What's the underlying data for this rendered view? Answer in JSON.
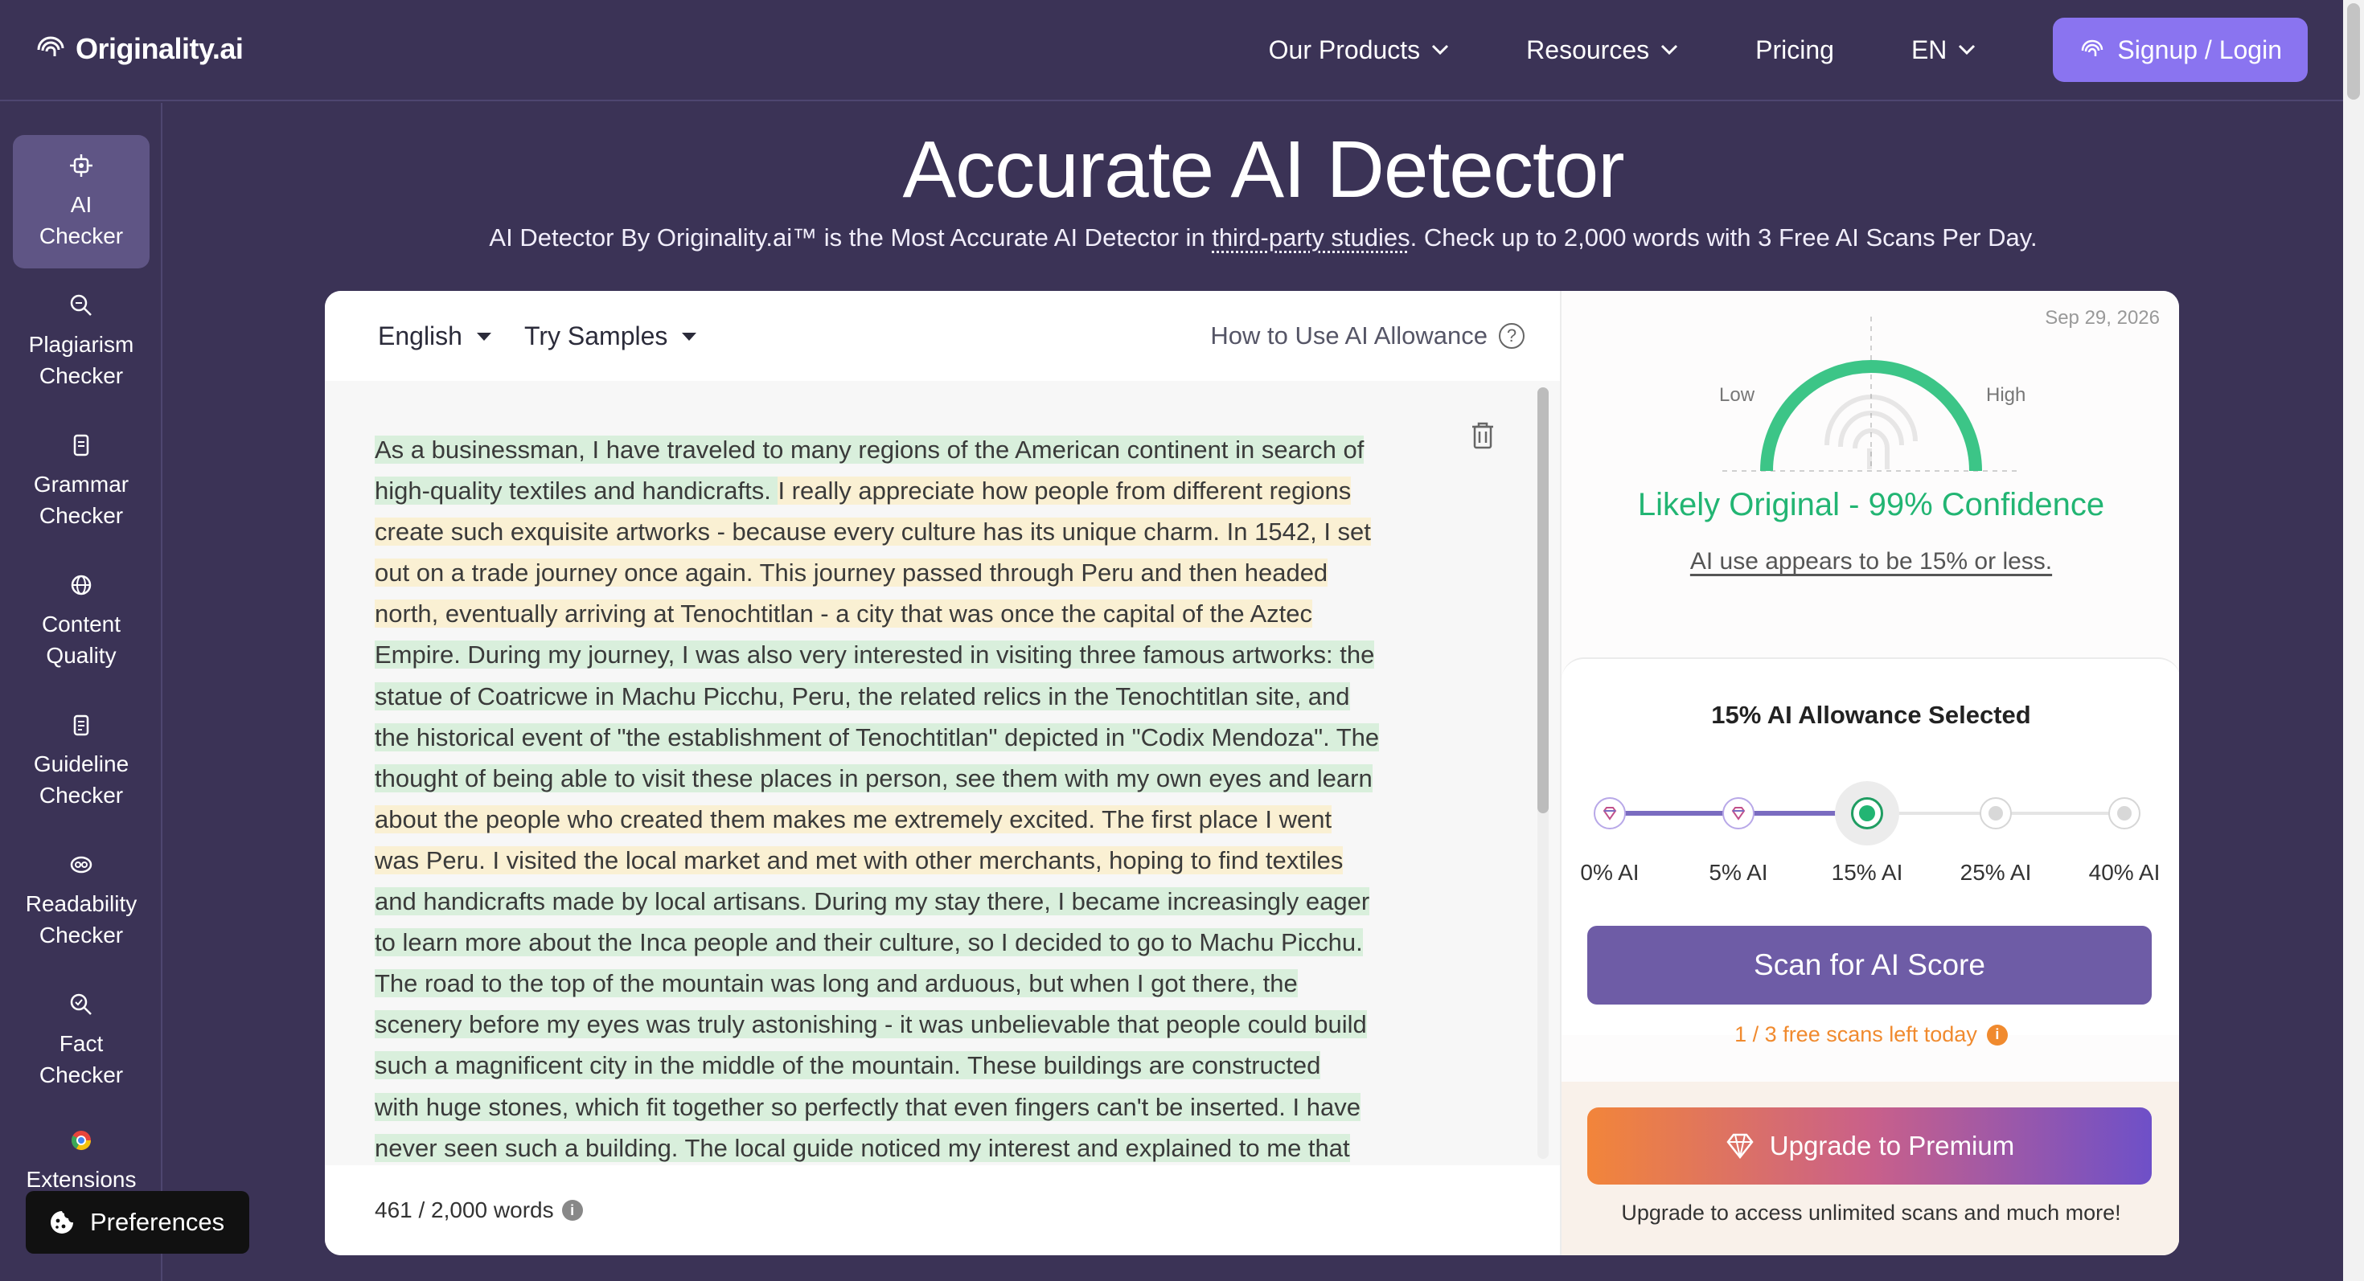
{
  "brand": {
    "name": "Originality.ai"
  },
  "nav": {
    "items": [
      {
        "label": "Our Products",
        "has_dropdown": true
      },
      {
        "label": "Resources",
        "has_dropdown": true
      },
      {
        "label": "Pricing",
        "has_dropdown": false
      },
      {
        "label": "EN",
        "has_dropdown": true
      }
    ],
    "signup_label": "Signup / Login"
  },
  "sidebar": {
    "items": [
      {
        "label": "AI Checker",
        "icon": "chip-icon",
        "active": true
      },
      {
        "label": "Plagiarism Checker",
        "icon": "search-icon"
      },
      {
        "label": "Grammar Checker",
        "icon": "doc-icon"
      },
      {
        "label": "Content Quality",
        "icon": "globe-icon"
      },
      {
        "label": "Guideline Checker",
        "icon": "clipboard-icon"
      },
      {
        "label": "Readability Checker",
        "icon": "eye-icon"
      },
      {
        "label": "Fact Checker",
        "icon": "magnify-check-icon"
      },
      {
        "label": "Extensions",
        "icon": "chrome-icon"
      }
    ]
  },
  "header": {
    "title": "Accurate AI Detector",
    "subtitle_pre": "AI Detector By Originality.ai™ is the Most Accurate AI Detector in ",
    "subtitle_link": "third-party studies",
    "subtitle_post": ". Check up to 2,000 words with 3 Free AI Scans Per Day."
  },
  "editor": {
    "language": "English",
    "samples_label": "Try Samples",
    "howto_label": "How to Use AI Allowance",
    "word_count": "461 / 2,000 words",
    "lines": [
      [
        {
          "t": "As a businessman, I have traveled to many regions of the American continent in search of",
          "h": "g"
        }
      ],
      [
        {
          "t": "high-quality textiles and handicrafts. ",
          "h": "g"
        },
        {
          "t": "I really appreciate how people from different regions",
          "h": "y"
        }
      ],
      [
        {
          "t": "create such exquisite artworks - because every culture has its unique charm. In 1542, I set",
          "h": "y"
        }
      ],
      [
        {
          "t": "out on a trade journey once again. This journey passed through Peru and then headed",
          "h": "y"
        }
      ],
      [
        {
          "t": "north, eventually arriving at Tenochtitlan - a city that was once the capital of the Aztec",
          "h": "y"
        }
      ],
      [
        {
          "t": "Empire. During my journey, I was also very interested in visiting three famous artworks: the",
          "h": "g"
        }
      ],
      [
        {
          "t": "statue of Coatricwe in Machu Picchu, Peru, the related relics in the Tenochtitlan site, and",
          "h": "g"
        }
      ],
      [
        {
          "t": "the historical event of \"the establishment of Tenochtitlan\" depicted in \"Codix Mendoza\". The",
          "h": "g"
        }
      ],
      [
        {
          "t": "thought of being able to visit these places in person, see them with my own eyes and learn",
          "h": "g"
        }
      ],
      [
        {
          "t": "about the people who created them makes me extremely excited. The first place I went",
          "h": "y"
        }
      ],
      [
        {
          "t": "was Peru. I visited the local market and met with other merchants, hoping to find textiles",
          "h": "y"
        }
      ],
      [
        {
          "t": "and handicrafts made by local artisans. During my stay there, I became increasingly eager",
          "h": "g"
        }
      ],
      [
        {
          "t": "to learn more about the Inca people and their culture, so I decided to go to Machu Picchu.",
          "h": "g"
        }
      ],
      [
        {
          "t": "The road to the top of the mountain was long and arduous, but when I got there, the",
          "h": "g"
        }
      ],
      [
        {
          "t": "scenery before my eyes was truly astonishing - it was unbelievable that people could build",
          "h": "g"
        }
      ],
      [
        {
          "t": "such a magnificent city in the middle of the mountain. These buildings are constructed",
          "h": "g"
        }
      ],
      [
        {
          "t": "with huge stones, which fit together so perfectly that even fingers can't be inserted. I have",
          "h": "g"
        }
      ],
      [
        {
          "t": "never seen such a building. The local guide noticed my interest and explained to me that",
          "h": "g"
        }
      ]
    ]
  },
  "result": {
    "date": "Sep 29, 2026",
    "gauge_low": "Low",
    "gauge_high": "High",
    "original_percent": 99,
    "headline": "Likely Original - 99% Confidence",
    "sub": "AI use appears to be 15% or less."
  },
  "allowance": {
    "title": "15% AI Allowance Selected",
    "selected_index": 2,
    "stops": [
      "0% AI",
      "5% AI",
      "15% AI",
      "25% AI",
      "40% AI"
    ],
    "scan_label": "Scan for AI Score",
    "free_scans": "1 / 3 free scans left today",
    "upgrade_label": "Upgrade to Premium",
    "upgrade_note": "Upgrade to access unlimited scans and much more!"
  },
  "cookie": {
    "label": "Preferences"
  },
  "colors": {
    "accent": "#8a74f0",
    "bg": "#3b3356",
    "success": "#22b573",
    "warning": "#f08a2e",
    "scan_button": "#6e5ca6"
  }
}
